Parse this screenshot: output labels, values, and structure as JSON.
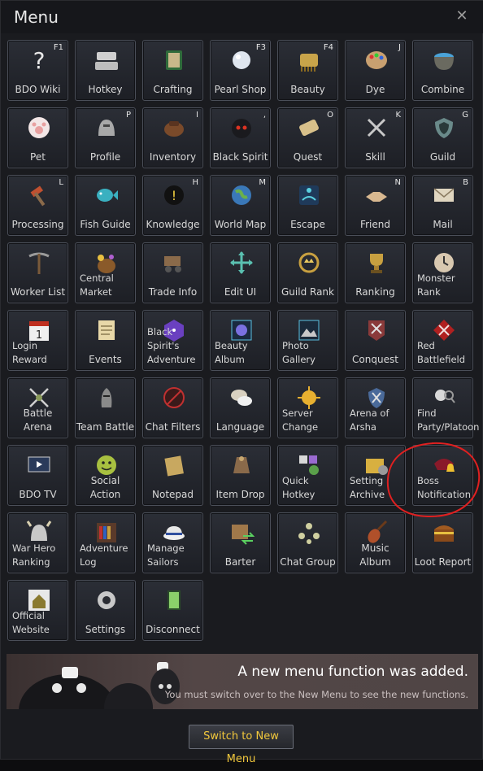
{
  "window": {
    "title": "Menu",
    "close_symbol": "✕"
  },
  "tiles": [
    {
      "label": "BDO Wiki",
      "hotkey": "F1",
      "icon": "question-icon"
    },
    {
      "label": "Hotkey",
      "hotkey": "",
      "icon": "keyboard-icon"
    },
    {
      "label": "Crafting",
      "hotkey": "",
      "icon": "crafting-book-icon"
    },
    {
      "label": "Pearl Shop",
      "hotkey": "F3",
      "icon": "pearl-icon"
    },
    {
      "label": "Beauty",
      "hotkey": "F4",
      "icon": "comb-icon"
    },
    {
      "label": "Dye",
      "hotkey": "J",
      "icon": "palette-icon"
    },
    {
      "label": "Combine",
      "hotkey": "",
      "icon": "cauldron-icon"
    },
    {
      "label": "Pet",
      "hotkey": "",
      "icon": "paw-icon"
    },
    {
      "label": "Profile",
      "hotkey": "P",
      "icon": "helmet-icon"
    },
    {
      "label": "Inventory",
      "hotkey": "I",
      "icon": "bag-icon"
    },
    {
      "label": "Black Spirit",
      "hotkey": ",",
      "icon": "black-spirit-icon"
    },
    {
      "label": "Quest",
      "hotkey": "O",
      "icon": "scroll-icon"
    },
    {
      "label": "Skill",
      "hotkey": "K",
      "icon": "crossed-axes-icon"
    },
    {
      "label": "Guild",
      "hotkey": "G",
      "icon": "guild-shield-icon"
    },
    {
      "label": "Processing",
      "hotkey": "L",
      "icon": "hammer-icon"
    },
    {
      "label": "Fish Guide",
      "hotkey": "",
      "icon": "fish-icon"
    },
    {
      "label": "Knowledge",
      "hotkey": "H",
      "icon": "head-bulb-icon"
    },
    {
      "label": "World Map",
      "hotkey": "M",
      "icon": "globe-icon"
    },
    {
      "label": "Escape",
      "hotkey": "",
      "icon": "escape-icon"
    },
    {
      "label": "Friend",
      "hotkey": "N",
      "icon": "handshake-icon"
    },
    {
      "label": "Mail",
      "hotkey": "B",
      "icon": "envelope-icon"
    },
    {
      "label": "Worker List",
      "hotkey": "",
      "icon": "pickaxe-icon"
    },
    {
      "label": "Central Market",
      "hotkey": "",
      "icon": "money-bag-icon",
      "multiline": true
    },
    {
      "label": "Trade Info",
      "hotkey": "",
      "icon": "wagon-icon"
    },
    {
      "label": "Edit UI",
      "hotkey": "",
      "icon": "move-arrows-icon"
    },
    {
      "label": "Guild Rank",
      "hotkey": "",
      "icon": "laurel-crown-icon"
    },
    {
      "label": "Ranking",
      "hotkey": "",
      "icon": "trophy-icon"
    },
    {
      "label": "Monster Rank",
      "hotkey": "",
      "icon": "monster-clock-icon",
      "multiline": true
    },
    {
      "label": "Login Reward",
      "hotkey": "",
      "icon": "calendar-icon",
      "multiline": true
    },
    {
      "label": "Events",
      "hotkey": "",
      "icon": "notepad-icon"
    },
    {
      "label": "Black Spirit's Adventure",
      "hotkey": "",
      "icon": "dice-icon",
      "multiline": true
    },
    {
      "label": "Beauty Album",
      "hotkey": "",
      "icon": "album-icon",
      "multiline": true
    },
    {
      "label": "Photo Gallery",
      "hotkey": "",
      "icon": "photo-icon",
      "multiline": true
    },
    {
      "label": "Conquest",
      "hotkey": "",
      "icon": "conquest-banner-icon"
    },
    {
      "label": "Red Battlefield",
      "hotkey": "",
      "icon": "red-battlefield-icon",
      "multiline": true
    },
    {
      "label": "Battle Arena",
      "hotkey": "",
      "icon": "crossed-swords-icon"
    },
    {
      "label": "Team Battle",
      "hotkey": "",
      "icon": "knight-icon"
    },
    {
      "label": "Chat Filters",
      "hotkey": "",
      "icon": "chat-filter-icon"
    },
    {
      "label": "Language",
      "hotkey": "",
      "icon": "speech-bubble-icon"
    },
    {
      "label": "Server Change",
      "hotkey": "",
      "icon": "server-icon",
      "multiline": true
    },
    {
      "label": "Arena of Arsha",
      "hotkey": "",
      "icon": "arena-icon",
      "multiline": true
    },
    {
      "label": "Find Party/Platoon",
      "hotkey": "",
      "icon": "find-party-icon",
      "multiline": true
    },
    {
      "label": "BDO TV",
      "hotkey": "",
      "icon": "tv-icon"
    },
    {
      "label": "Social Action",
      "hotkey": "",
      "icon": "smiley-icon"
    },
    {
      "label": "Notepad",
      "hotkey": "",
      "icon": "note-icon"
    },
    {
      "label": "Item Drop",
      "hotkey": "",
      "icon": "item-drop-icon"
    },
    {
      "label": "Quick Hotkey",
      "hotkey": "",
      "icon": "quick-hotkey-icon",
      "multiline": true
    },
    {
      "label": "Setting Archive",
      "hotkey": "",
      "icon": "folder-gear-icon",
      "multiline": true
    },
    {
      "label": "Boss Notification",
      "hotkey": "",
      "icon": "boss-bell-icon",
      "multiline": true
    },
    {
      "label": "War Hero Ranking",
      "hotkey": "",
      "icon": "war-helmet-icon",
      "multiline": true
    },
    {
      "label": "Adventure Log",
      "hotkey": "",
      "icon": "bookshelf-icon",
      "multiline": true
    },
    {
      "label": "Manage Sailors",
      "hotkey": "",
      "icon": "sailor-hat-icon",
      "multiline": true
    },
    {
      "label": "Barter",
      "hotkey": "",
      "icon": "crate-icon"
    },
    {
      "label": "Chat Group",
      "hotkey": "",
      "icon": "group-icon"
    },
    {
      "label": "Music Album",
      "hotkey": "",
      "icon": "violin-icon"
    },
    {
      "label": "Loot Report",
      "hotkey": "",
      "icon": "treasure-chest-icon"
    },
    {
      "label": "Official Website",
      "hotkey": "",
      "icon": "house-icon",
      "multiline": true
    },
    {
      "label": "Settings",
      "hotkey": "",
      "icon": "gear-icon"
    },
    {
      "label": "Disconnect",
      "hotkey": "",
      "icon": "door-icon"
    }
  ],
  "banner": {
    "headline": "A new menu function was added.",
    "subtext": "You must switch over to the New Menu to see the new functions."
  },
  "footer": {
    "switch_label": "Switch to New Menu"
  },
  "colors": {
    "accent_text": "#f2c83c",
    "annotation_red": "#e02020"
  }
}
